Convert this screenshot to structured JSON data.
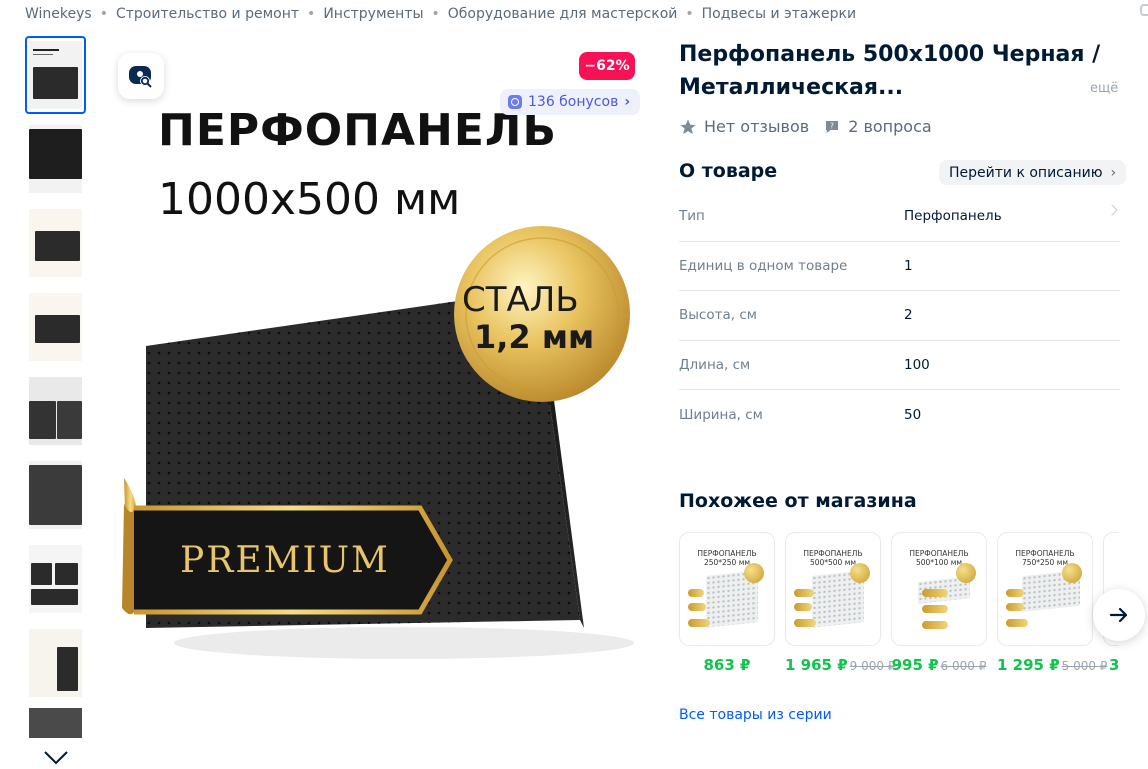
{
  "breadcrumb": [
    "Winekeys",
    "Строительство и ремонт",
    "Инструменты",
    "Оборудование для мастерской",
    "Подвесы и этажерки"
  ],
  "gallery": {
    "thumbnail_count": 9,
    "discount": "−62%",
    "bonus": "136 бонусов",
    "promo": {
      "title": "ПЕРФОПАНЕЛЬ",
      "size": "1000x500 мм",
      "badge_line1": "СТАЛЬ",
      "badge_line2": "1,2 мм",
      "ribbon": "PREMIUM"
    }
  },
  "product": {
    "title": "Перфопанель 500х1000 Черная / Металлическая...",
    "more": "ещё",
    "reviews": "Нет отзывов",
    "questions": "2 вопроса"
  },
  "about": {
    "title": "О товаре",
    "goto_label": "Перейти к описанию",
    "specs": [
      {
        "label": "Тип",
        "value": "Перфопанель"
      },
      {
        "label": "Единиц в одном товаре",
        "value": "1"
      },
      {
        "label": "Высота, см",
        "value": "2"
      },
      {
        "label": "Длина, см",
        "value": "100"
      },
      {
        "label": "Ширина, см",
        "value": "50"
      }
    ]
  },
  "similar": {
    "title": "Похожее от магазина",
    "items": [
      {
        "caption_line1": "ПЕРФОПАНЕЛЬ",
        "caption_line2": "250*250 мм",
        "price": "863 ₽",
        "old_price": ""
      },
      {
        "caption_line1": "ПЕРФОПАНЕЛЬ",
        "caption_line2": "500*500 мм",
        "price": "1 965 ₽",
        "old_price": "9 000 ₽"
      },
      {
        "caption_line1": "ПЕРФОПАНЕЛЬ",
        "caption_line2": "500*100 мм",
        "price": "995 ₽",
        "old_price": "6 000 ₽"
      },
      {
        "caption_line1": "ПЕРФОПАНЕЛЬ",
        "caption_line2": "750*250 мм",
        "price": "1 295 ₽",
        "old_price": "5 000 ₽"
      },
      {
        "caption_line1": "",
        "caption_line2": "",
        "price": "3",
        "old_price": ""
      }
    ],
    "series_link": "Все товары из серии"
  },
  "colors": {
    "accent": "#005bff",
    "discount": "#f91155",
    "price_green": "#10c44c",
    "bonus": "#4d5bd6"
  }
}
